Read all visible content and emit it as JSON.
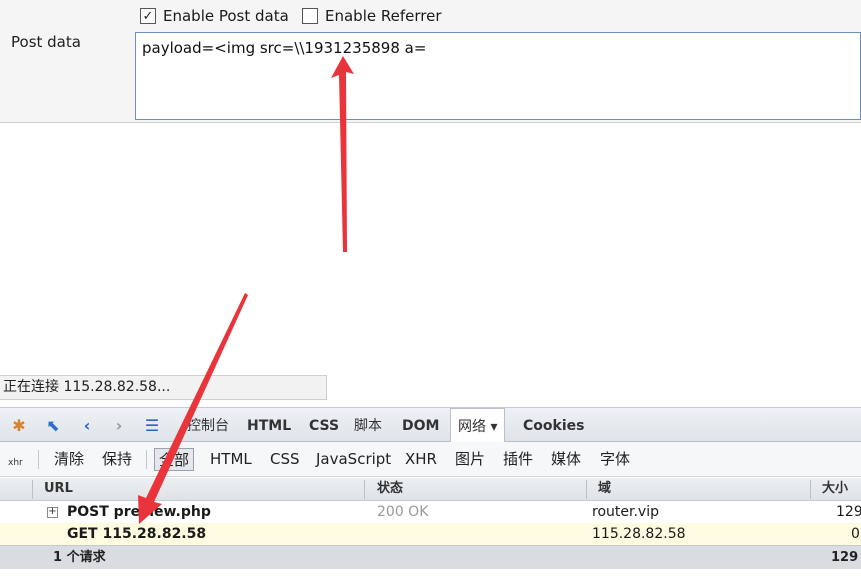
{
  "post_panel": {
    "enable_post_label": "Enable Post data",
    "enable_post_checked": "✓",
    "enable_referrer_label": "Enable Referrer",
    "post_data_label": "Post data",
    "post_data_value": "payload=<img src=\\\\1931235898 a="
  },
  "status_bar": {
    "text": "正在连接 115.28.82.58..."
  },
  "firebug": {
    "tabs": [
      "控制台",
      "HTML",
      "CSS",
      "脚本",
      "DOM",
      "网络",
      "Cookies"
    ],
    "active_tab_caret": "▾",
    "net_filters": {
      "clear": "清除",
      "persist": "保持",
      "all": "全部",
      "html": "HTML",
      "css": "CSS",
      "js": "JavaScript",
      "xhr": "XHR",
      "images": "图片",
      "plugins": "插件",
      "media": "媒体",
      "fonts": "字体"
    },
    "xhr_badge": "xhr",
    "columns": {
      "url": "URL",
      "status": "状态",
      "domain": "域",
      "size": "大小"
    },
    "rows": [
      {
        "url": "POST preview.php",
        "status": "200 OK",
        "domain": "router.vip",
        "size": "129"
      },
      {
        "url": "GET 115.28.82.58",
        "status": "",
        "domain": "115.28.82.58",
        "size": "0"
      }
    ],
    "summary": {
      "count": "1 个请求",
      "size": "129"
    }
  },
  "colors": {
    "arrow": "#e8343a",
    "selected_row": "#fffbe0"
  }
}
